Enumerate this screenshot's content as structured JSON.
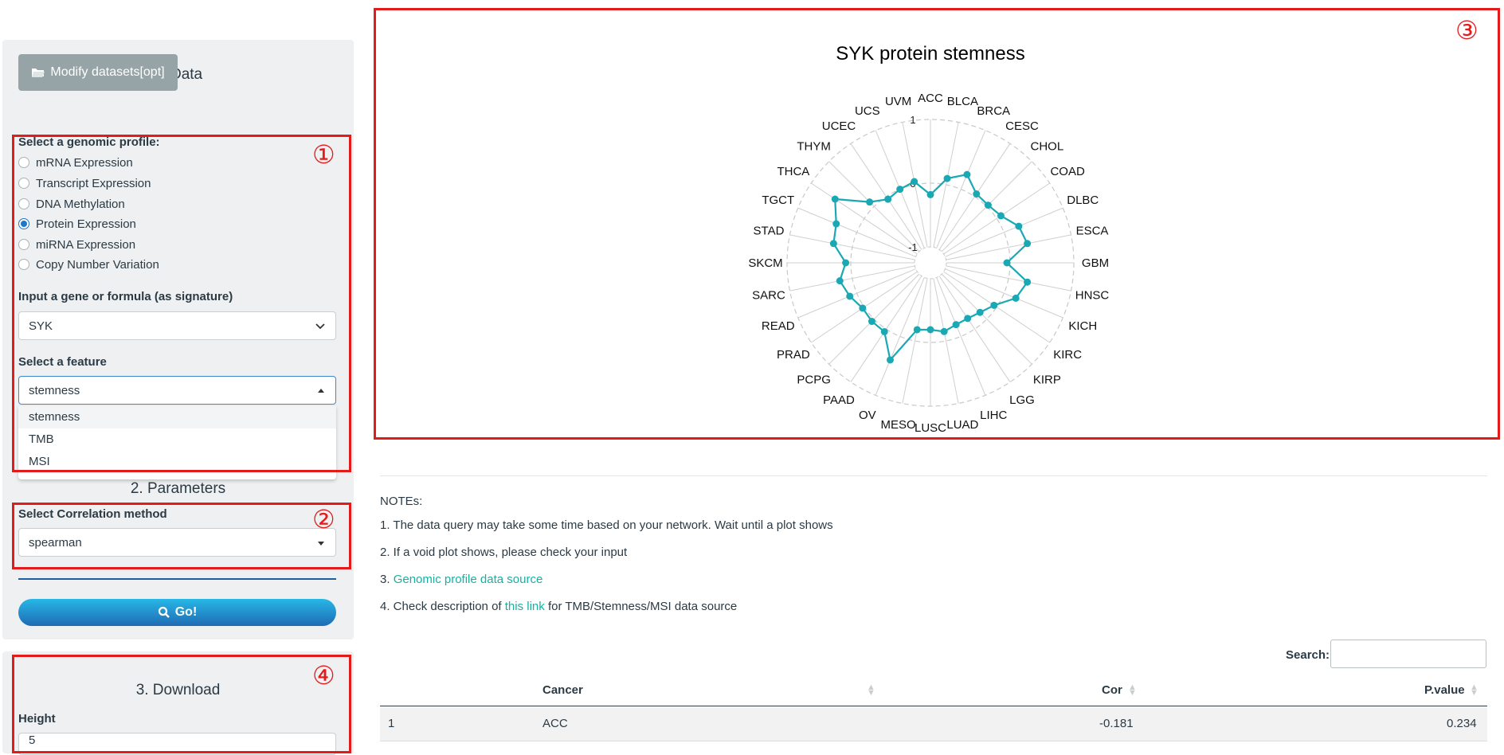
{
  "sidebar": {
    "data_panel": {
      "title": "1. Data",
      "modify_button": "Modify datasets[opt]",
      "profile_label": "Select a genomic profile:",
      "profiles": [
        {
          "label": "mRNA Expression",
          "selected": false
        },
        {
          "label": "Transcript Expression",
          "selected": false
        },
        {
          "label": "DNA Methylation",
          "selected": false
        },
        {
          "label": "Protein Expression",
          "selected": true
        },
        {
          "label": "miRNA Expression",
          "selected": false
        },
        {
          "label": "Copy Number Variation",
          "selected": false
        }
      ],
      "gene_label": "Input a gene or formula (as signature)",
      "gene_value": "SYK",
      "feature_label": "Select a feature",
      "feature_value": "stemness",
      "feature_options": [
        "stemness",
        "TMB",
        "MSI"
      ]
    },
    "params_panel": {
      "title": "2. Parameters",
      "method_label": "Select Correlation method",
      "method_value": "spearman",
      "go_button": "Go!"
    },
    "download_panel": {
      "title": "3. Download",
      "height_label": "Height",
      "height_value": "5"
    }
  },
  "annotations": {
    "n1": "①",
    "n2": "②",
    "n3": "③",
    "n4": "④",
    "color": "#e31b1b"
  },
  "chart_data": {
    "type": "radar",
    "title": "SYK protein stemness",
    "categories": [
      "ACC",
      "BLCA",
      "BRCA",
      "CESC",
      "CHOL",
      "COAD",
      "DLBC",
      "ESCA",
      "GBM",
      "HNSC",
      "KICH",
      "KIRC",
      "KIRP",
      "LGG",
      "LIHC",
      "LUAD",
      "LUSC",
      "MESO",
      "OV",
      "PAAD",
      "PCPG",
      "PRAD",
      "READ",
      "SARC",
      "SKCM",
      "STAD",
      "TGCT",
      "THCA",
      "THYM",
      "UCEC",
      "UCS",
      "UVM"
    ],
    "series": [
      {
        "values": [
          -0.18,
          0.1,
          0.25,
          0.05,
          0.03,
          0.08,
          0.25,
          0.3,
          -0.05,
          0.3,
          0.2,
          -0.05,
          -0.15,
          -0.2,
          -0.2,
          -0.15,
          -0.2,
          -0.18,
          0.4,
          0.05,
          0.05,
          0.03,
          0.12,
          0.2,
          0.08,
          0.3,
          0.35,
          0.55,
          0.1,
          -0.05,
          0.0,
          0.05
        ],
        "color": "#1aa9b4"
      }
    ],
    "rlim": [
      -1,
      1
    ],
    "ticks": [
      "-1",
      "0",
      "1"
    ]
  },
  "notes": {
    "heading": "NOTEs:",
    "n1": "1. The data query may take some time based on your network. Wait until a plot shows",
    "n2": "2. If a void plot shows, please check your input",
    "n3_prefix": "3. ",
    "n3_link": "Genomic profile data source",
    "n4_prefix": "4. Check description of ",
    "n4_link": "this link",
    "n4_suffix": " for TMB/Stemness/MSI data source"
  },
  "table": {
    "search_label": "Search:",
    "columns": [
      "Cancer",
      "Cor",
      "P.value"
    ],
    "rows": [
      {
        "index": "1",
        "cancer": "ACC",
        "cor": "-0.181",
        "pvalue": "0.234"
      }
    ]
  }
}
